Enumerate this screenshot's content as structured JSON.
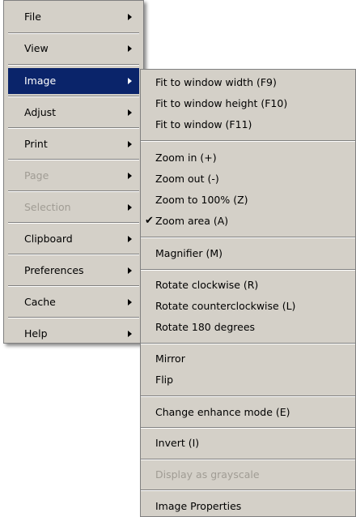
{
  "main_menu": {
    "items": [
      {
        "label": "File"
      },
      {
        "label": "View"
      },
      {
        "label": "Image"
      },
      {
        "label": "Adjust"
      },
      {
        "label": "Print"
      },
      {
        "label": "Page"
      },
      {
        "label": "Selection"
      },
      {
        "label": "Clipboard"
      },
      {
        "label": "Preferences"
      },
      {
        "label": "Cache"
      },
      {
        "label": "Help"
      }
    ]
  },
  "image_submenu": {
    "items": [
      {
        "label": "Fit to window width (F9)"
      },
      {
        "label": "Fit to window height (F10)"
      },
      {
        "label": "Fit to window (F11)"
      },
      {
        "label": "Zoom in (+)"
      },
      {
        "label": "Zoom out (-)"
      },
      {
        "label": "Zoom to 100% (Z)"
      },
      {
        "label": "Zoom area (A)",
        "check": "✔"
      },
      {
        "label": "Magnifier (M)"
      },
      {
        "label": "Rotate clockwise (R)"
      },
      {
        "label": "Rotate counterclockwise (L)"
      },
      {
        "label": "Rotate 180 degrees"
      },
      {
        "label": "Mirror"
      },
      {
        "label": "Flip"
      },
      {
        "label": "Change enhance mode (E)"
      },
      {
        "label": "Invert (I)"
      },
      {
        "label": "Display as grayscale"
      },
      {
        "label": "Image Properties"
      }
    ]
  },
  "colors": {
    "menu_bg": "#d4d0c8",
    "highlight": "#0a246a",
    "disabled_text": "#a09c94"
  },
  "icons": {
    "submenu_arrow": "submenu-arrow-icon",
    "checkmark": "checkmark-icon"
  }
}
